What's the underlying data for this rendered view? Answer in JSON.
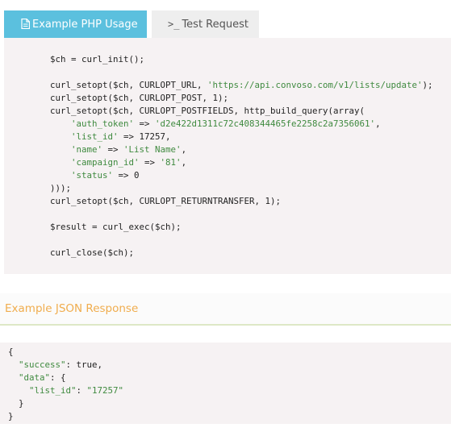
{
  "tabs": [
    {
      "label": "Example PHP Usage",
      "icon": "document-icon",
      "active": true
    },
    {
      "label": "Test Request",
      "icon": "terminal-icon",
      "active": false
    }
  ],
  "php_code": [
    "$ch = curl_init();",
    "",
    "curl_setopt($ch, CURLOPT_URL, 'https://api.convoso.com/v1/lists/update');",
    "curl_setopt($ch, CURLOPT_POST, 1);",
    "curl_setopt($ch, CURLOPT_POSTFIELDS, http_build_query(array(",
    "    'auth_token' => 'd2e422d1311c72c408344465fe2258c2a7356061',",
    "    'list_id' => 17257,",
    "    'name' => 'List Name',",
    "    'campaign_id' => '81',",
    "    'status' => 0",
    ")));",
    "curl_setopt($ch, CURLOPT_RETURNTRANSFER, 1);",
    "",
    "$result = curl_exec($ch);",
    "",
    "curl_close($ch);"
  ],
  "response_section": {
    "title": "Example JSON Response"
  },
  "json_code": [
    "{",
    "  \"success\": true,",
    "  \"data\": {",
    "    \"list_id\": \"17257\"",
    "  }",
    "}"
  ],
  "colors": {
    "active_tab": "#5bc0de",
    "inactive_tab": "#eeeeee",
    "code_background": "#f6f2f3",
    "string_literal": "#3f8a3f",
    "section_title": "#f0ad4e"
  }
}
